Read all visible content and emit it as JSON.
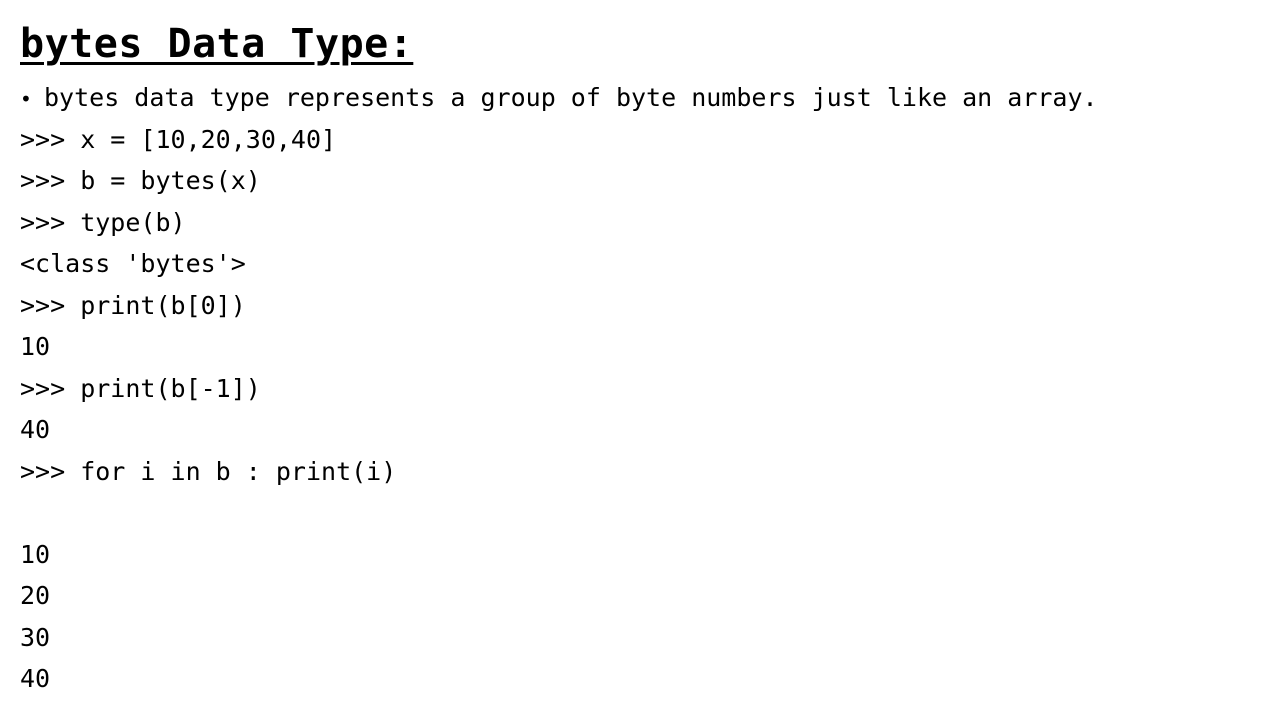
{
  "title": "bytes Data Type:",
  "bullet_symbol": "•",
  "bullet_text": "bytes data type represents a group of byte numbers just like an array.",
  "code_lines": [
    ">>> x = [10,20,30,40]",
    ">>> b = bytes(x)",
    ">>> type(b)",
    "<class 'bytes'>",
    ">>> print(b[0])",
    "10",
    ">>> print(b[-1])",
    "40",
    ">>> for i in b : print(i)",
    "",
    "10",
    "20",
    "30",
    "40"
  ]
}
